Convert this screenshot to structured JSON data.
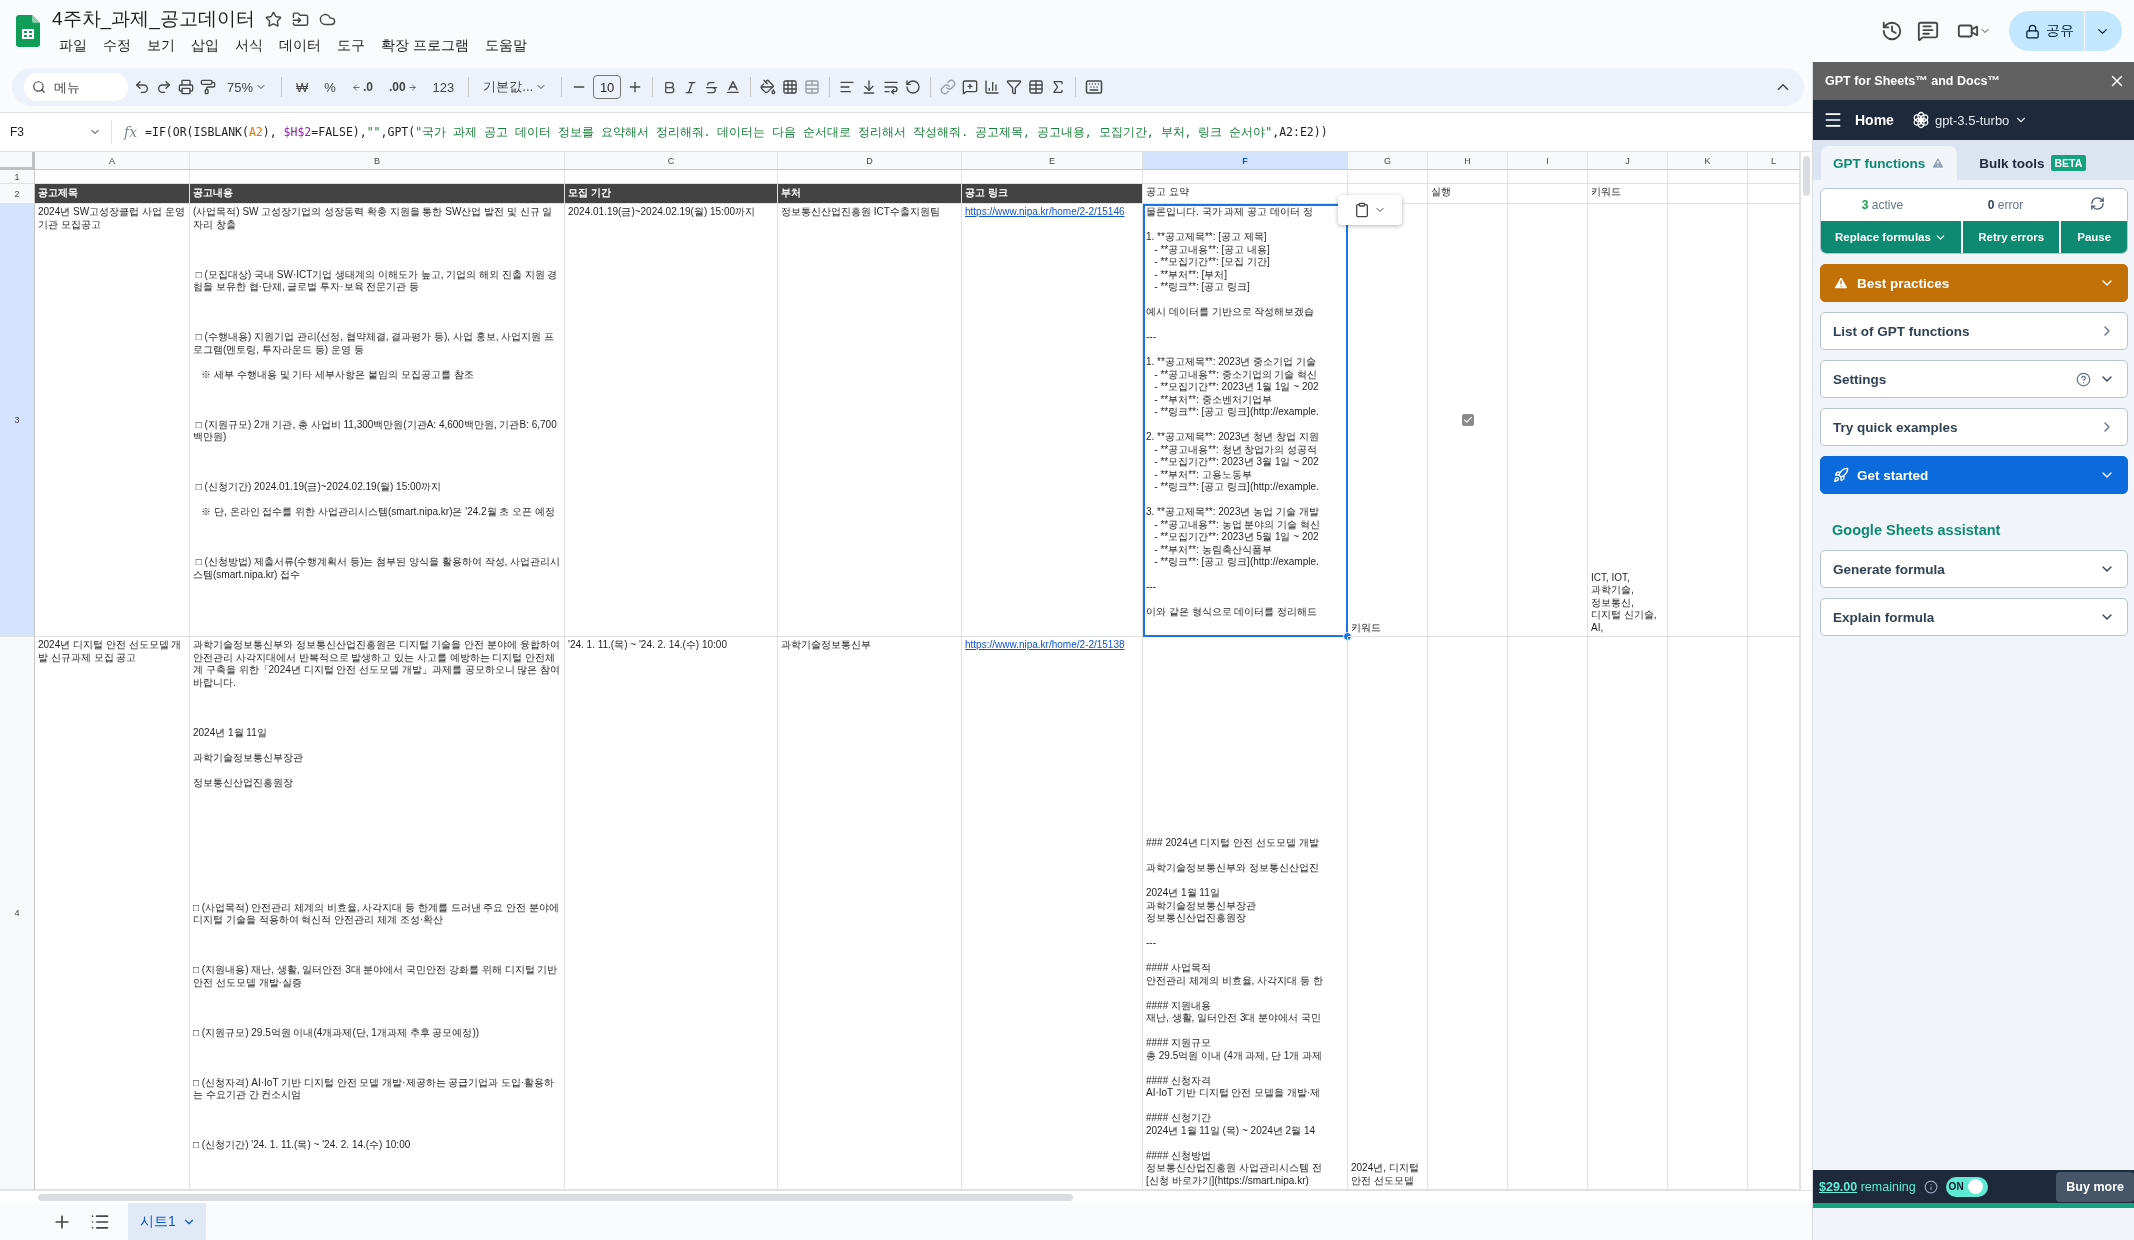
{
  "app": {
    "title": "4주차_과제_공고데이터",
    "menus": [
      "파일",
      "수정",
      "보기",
      "삽입",
      "서식",
      "데이터",
      "도구",
      "확장 프로그램",
      "도움말"
    ],
    "share_label": "공유"
  },
  "toolbar": {
    "search_placeholder": "메뉴",
    "zoom": "75%",
    "currency": "₩",
    "percent": "%",
    "decrease_decimal": ".0",
    "increase_decimal": ".00",
    "number_format": "123",
    "font": "기본값...",
    "font_size": "10"
  },
  "formula_bar": {
    "cell": "F3",
    "fx": "fx",
    "segments": [
      {
        "kind": "plain",
        "text": "=IF(OR(ISBLANK("
      },
      {
        "kind": "ref",
        "text": "A2",
        "color": "#e37400"
      },
      {
        "kind": "plain",
        "text": "), "
      },
      {
        "kind": "ref",
        "text": "$H$2",
        "color": "#8e24aa"
      },
      {
        "kind": "plain",
        "text": "=FALSE),"
      },
      {
        "kind": "string",
        "text": "\"\""
      },
      {
        "kind": "plain",
        "text": ",GPT("
      },
      {
        "kind": "string",
        "text": "\"국가 과제 공고 데이터 정보를 요약해서 정리해줘. 데이터는 다음 순서대로 정리해서 작성해줘. 공고제목, 공고내용, 모집기간, 부처, 링크 순서야\""
      },
      {
        "kind": "plain",
        "text": ",A2:E2))"
      }
    ]
  },
  "sheet": {
    "columns": [
      {
        "label": "A",
        "selected": false
      },
      {
        "label": "B",
        "selected": false
      },
      {
        "label": "C",
        "selected": false
      },
      {
        "label": "D",
        "selected": false
      },
      {
        "label": "E",
        "selected": false
      },
      {
        "label": "F",
        "selected": true
      },
      {
        "label": "G",
        "selected": false
      },
      {
        "label": "H",
        "selected": false
      },
      {
        "label": "I",
        "selected": false
      },
      {
        "label": "J",
        "selected": false
      },
      {
        "label": "K",
        "selected": false
      },
      {
        "label": "L",
        "selected": false
      }
    ],
    "rows": [
      {
        "number": "1",
        "selected": false
      },
      {
        "number": "2",
        "selected": false,
        "cells": {
          "A": {
            "kind": "header",
            "text": "공고제목",
            "selected": false
          },
          "B": {
            "kind": "header",
            "text": "공고내용",
            "selected": false
          },
          "C": {
            "kind": "header",
            "text": "모집 기간",
            "selected": false
          },
          "D": {
            "kind": "header",
            "text": "부처",
            "selected": false
          },
          "E": {
            "kind": "header",
            "text": "공고 링크",
            "selected": false
          },
          "F": {
            "kind": "text",
            "text": "공고 요약",
            "selected": false
          },
          "H": {
            "kind": "text",
            "text": "실행",
            "selected": false
          },
          "J": {
            "kind": "text",
            "text": "키워드",
            "selected": false
          }
        }
      },
      {
        "number": "3",
        "selected": true,
        "cells": {
          "A": {
            "kind": "text",
            "text": "2024년 SW고성장클럽 사업 운영기관 모집공고",
            "selected": false
          },
          "B": {
            "kind": "text",
            "text": "(사업목적) SW 고성장기업의 성장동력 확충 지원을 통한 SW산업 발전 및 신규 일자리 창출\n\n\n\n □ (모집대상) 국내 SW·ICT기업 생태계의 이해도가 높고, 기업의 해외 진출 지원 경험을 보유한 협·단체, 글로벌 투자·보육 전문기관 등\n\n\n\n □ (수행내용) 지원기업 관리(선정, 협약체결, 결과평가 등), 사업 홍보, 사업지원 프로그램(멘토링, 투자라운드 등) 운영 등\n\n   ※ 세부 수행내용 및 기타 세부사항은 붙임의 모집공고를 참조\n\n\n\n □ (지원규모) 2개 기관, 총 사업비 11,300백만원(기관A: 4,600백만원, 기관B: 6,700백만원)\n\n\n\n □ (신청기간) 2024.01.19(금)~2024.02.19(월) 15:00까지\n\n   ※ 단, 온라인 접수를 위한 사업관리시스템(smart.nipa.kr)은 '24.2월 초 오픈 예정\n\n\n\n □ (신청방법) 제출서류(수행계획서 등)는 첨부된 양식을 활용하여 작성, 사업관리시스템(smart.nipa.kr) 접수",
            "selected": false
          },
          "C": {
            "kind": "text",
            "text": "2024.01.19(금)~2024.02.19(월) 15:00까지",
            "selected": false
          },
          "D": {
            "kind": "text",
            "text": "정보통신산업진흥원 ICT수출지원팀",
            "selected": false
          },
          "E": {
            "kind": "link",
            "text": "https://www.nipa.kr/home/2-2/15146",
            "selected": false
          },
          "F": {
            "kind": "clipped",
            "text": "물론입니다. 국가 과제 공고 데이터 정\n\n1. **공고제목**: [공고 제목]\n   - **공고내용**: [공고 내용]\n   - **모집기간**: [모집 기간]\n   - **부처**: [부처]\n   - **링크**: [공고 링크]\n\n예시 데이터를 기반으로 작성해보겠습\n\n---\n\n1. **공고제목**: 2023년 중소기업 기술\n   - **공고내용**: 중소기업의 기술 혁신\n   - **모집기간**: 2023년 1월 1일 ~ 202\n   - **부처**: 중소벤처기업부\n   - **링크**: [공고 링크](http://example.\n\n2. **공고제목**: 2023년 청년 창업 지원\n   - **공고내용**: 청년 창업가의 성공적\n   - **모집기간**: 2023년 3월 1일 ~ 202\n   - **부처**: 고용노동부\n   - **링크**: [공고 링크](http://example.\n\n3. **공고제목**: 2023년 농업 기술 개발\n   - **공고내용**: 농업 분야의 기술 혁신\n   - **모집기간**: 2023년 5월 1일 ~ 202\n   - **부처**: 농림축산식품부\n   - **링크**: [공고 링크](http://example.\n\n---\n\n이와 같은 형식으로 데이터를 정리해드",
            "selected": true
          },
          "G": {
            "kind": "bottom",
            "text": "키워드",
            "selected": false
          },
          "H": {
            "kind": "checkbox",
            "checked": true,
            "selected": false
          },
          "J": {
            "kind": "bottom",
            "text": "ICT, IOT,\n과학기술,\n정보통신,\n디지털 신기술,\nAI,",
            "selected": false
          }
        }
      },
      {
        "number": "4",
        "selected": false,
        "cells": {
          "A": {
            "kind": "text",
            "text": "2024년 디지털 안전 선도모델 개발 신규과제 모집 공고",
            "selected": false
          },
          "B": {
            "kind": "text",
            "text": "과학기술정보통신부와 정보통신산업진흥원은 디지털 기술을 안전 분야에 융합하여 안전관리 사각지대에서 반복적으로 발생하고 있는 사고를 예방하는 디지털 안전체계 구축을 위한「2024년 디지털 안전 선도모델 개발」과제를 공모하오니 많은 참여 바랍니다.\n\n\n\n2024년 1월 11일\n\n과학기술정보통신부장관\n\n정보통신산업진흥원장\n\n\n\n\n\n\n\n\n\n□ (사업목적) 안전관리 체계의 비효율, 사각지대 등 한계를 드러낸 주요 안전 분야에 디지털 기술을 적용하여 혁신적 안전관리 체계 조성·확산\n\n\n\n□ (지원내용) 재난, 생활, 일터안전 3대 분야에서 국민안전 강화를 위해 디지털 기반 안전 선도모델 개발·실증\n\n\n\n□ (지원규모) 29.5억원 이내(4개과제(단, 1개과제 추후 공모예정))\n\n\n\n□ (신청자격) AI·IoT 기반 디지털 안전 모델 개발·제공하는 공급기업과 도입·활용하는 수요기관 간 컨소시엄\n\n\n\n□ (신청기간) '24. 1. 11.(목) ~ '24. 2. 14.(수) 10:00",
            "selected": false
          },
          "C": {
            "kind": "text",
            "text": "'24. 1. 11.(목) ~ '24. 2. 14.(수) 10:00",
            "selected": false
          },
          "D": {
            "kind": "text",
            "text": "과학기술정보통신부",
            "selected": false
          },
          "E": {
            "kind": "link",
            "text": "https://www.nipa.kr/home/2-2/15138",
            "selected": false
          },
          "F": {
            "kind": "bottom",
            "text": "### 2024년 디지털 안전 선도모델 개발\n\n과학기술정보통신부와 정보통신산업진\n\n2024년 1월 11일\n과학기술정보통신부장관\n정보통신산업진흥원장\n\n---\n\n#### 사업목적\n안전관리 체계의 비효율, 사각지대 등 한\n\n#### 지원내용\n재난, 생활, 일터안전 3대 분야에서 국민\n\n#### 지원규모\n총 29.5억원 이내 (4개 과제, 단 1개 과제\n\n#### 신청자격\nAI·IoT 기반 디지털 안전 모델을 개발·제\n\n#### 신청기간\n2024년 1월 11일 (목) ~ 2024년 2월 14\n\n#### 신청방법\n정보통신산업진흥원 사업관리시스템 전\n[신청 바로가기](https://smart.nipa.kr)",
            "selected": false
          },
          "G": {
            "kind": "bottom",
            "text": "2024년, 디지털\n안전 선도모델",
            "selected": false
          }
        }
      }
    ]
  },
  "sheet_tabs": [
    {
      "label": "시트1",
      "selected": true
    }
  ],
  "panel": {
    "title": "GPT for Sheets™ and Docs™",
    "nav_title": "Home",
    "model": "gpt-3.5-turbo",
    "tabs": [
      {
        "label": "GPT functions",
        "selected": true,
        "warning": true
      },
      {
        "label": "Bulk tools",
        "selected": false,
        "warning": false,
        "badge": "BETA"
      }
    ],
    "status": {
      "active_count": "3",
      "active_label": "active",
      "error_count": "0",
      "error_label": "error"
    },
    "actions": [
      {
        "label": "Replace formulas",
        "menu": true
      },
      {
        "label": "Retry errors",
        "menu": false
      },
      {
        "label": "Pause",
        "menu": false
      }
    ],
    "sections": [
      {
        "label": "Best practices",
        "kind": "warning",
        "help": false
      },
      {
        "label": "List of GPT functions",
        "kind": "navigate",
        "help": false
      },
      {
        "label": "Settings",
        "kind": "expand",
        "help": true
      },
      {
        "label": "Try quick examples",
        "kind": "navigate",
        "help": false
      },
      {
        "label": "Get started",
        "kind": "primary",
        "help": false
      }
    ],
    "assistant_title": "Google Sheets assistant",
    "assistant_items": [
      {
        "label": "Generate formula",
        "kind": "expand",
        "help": false
      },
      {
        "label": "Explain formula",
        "kind": "expand",
        "help": false
      }
    ],
    "footer": {
      "remaining": "**$29.00** remaining",
      "toggle_label": "ON",
      "toggle_on": true,
      "buy_label": "Buy more"
    }
  }
}
